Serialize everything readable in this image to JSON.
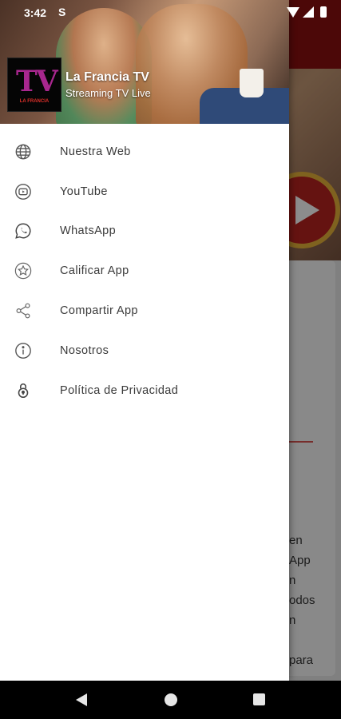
{
  "status_bar": {
    "time": "3:42",
    "notification_glyph": "S"
  },
  "drawer": {
    "header": {
      "title": "La Francia TV",
      "subtitle": "Streaming TV Live",
      "logo_text": "TV",
      "logo_subtext": "LA FRANCIA"
    },
    "menu": [
      {
        "icon": "globe-icon",
        "label": "Nuestra Web"
      },
      {
        "icon": "youtube-icon",
        "label": "YouTube"
      },
      {
        "icon": "whatsapp-icon",
        "label": "WhatsApp"
      },
      {
        "icon": "star-icon",
        "label": "Calificar App"
      },
      {
        "icon": "share-icon",
        "label": "Compartir App"
      },
      {
        "icon": "info-icon",
        "label": "Nosotros"
      },
      {
        "icon": "lock-icon",
        "label": "Política de Privacidad"
      }
    ]
  },
  "background_app": {
    "text_fragments": [
      "en",
      "App",
      "n",
      "odos",
      "n",
      "",
      "para"
    ]
  },
  "colors": {
    "app_bar": "#8b0f0f",
    "drawer_bg": "#ffffff",
    "menu_text": "#3a3a3a",
    "logo_accent": "#a8278e"
  }
}
